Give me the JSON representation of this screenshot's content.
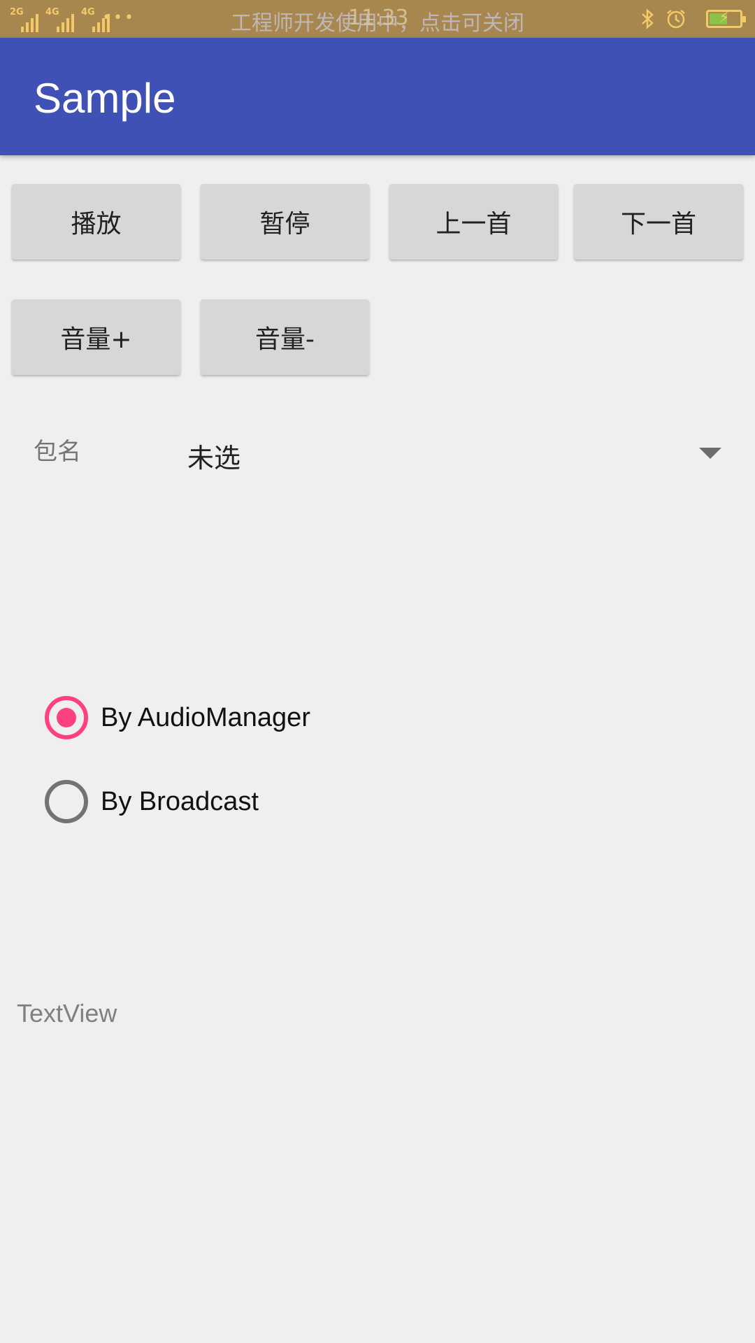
{
  "status_bar": {
    "signals": [
      {
        "label": "2G",
        "bars": 4
      },
      {
        "label": "4G",
        "bars": 4
      },
      {
        "label": "4G",
        "bars": 4
      }
    ],
    "more": "•••",
    "notice": "工程师开发使用中，点击可关闭",
    "time": "11:33",
    "icons": [
      "bluetooth-icon",
      "alarm-icon",
      "battery-icon"
    ],
    "battery_level": 0.6
  },
  "app_bar": {
    "title": "Sample"
  },
  "controls": {
    "play": "播放",
    "pause": "暂停",
    "prev": "上一首",
    "next": "下一首",
    "vol_up": "音量+",
    "vol_down": "音量-"
  },
  "package": {
    "label": "包名",
    "selected": "未选"
  },
  "mode": {
    "options": [
      {
        "label": "By AudioManager",
        "checked": true
      },
      {
        "label": "By Broadcast",
        "checked": false
      }
    ]
  },
  "output": {
    "text": "TextView"
  },
  "colors": {
    "status_bar": "#a8874f",
    "primary": "#3f51b5",
    "accent": "#ff4081",
    "background": "#efefef",
    "button": "#d6d7d7"
  }
}
